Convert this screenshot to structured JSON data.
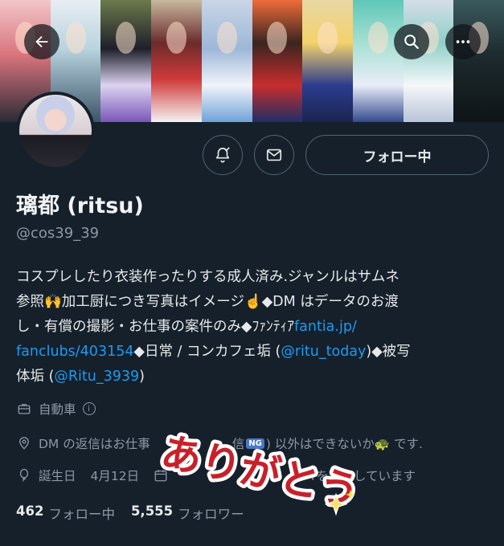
{
  "header": {
    "back_icon": "arrow-left-icon",
    "search_icon": "search-icon",
    "more_icon": "more-horizontal-icon"
  },
  "profile": {
    "name": "璃都 (ritsu)",
    "handle": "@cos39_39",
    "follow_button": "フォロー中",
    "bio": {
      "line1": "コスプレしたり衣装作ったりする成人済み.ジャンルはサムネ",
      "line2a": "参照🙌加工厨につき写真はイメージ☝️◆DM はデータのお渡",
      "line3a": "し・有償の撮影・お仕事の案件のみ◆ﾌｧﾝﾃｨｱ",
      "link1": "fantia.jp/",
      "link1b": "fanclubs/403154",
      "line4a": "◆日常 / コンカフェ垢 (",
      "link2": "@ritu_today",
      "line4b": ")◆被写",
      "line5a": "体垢 (",
      "link3": "@Ritu_3939",
      "line5b": ")"
    },
    "category": "自動車",
    "location_a": "DM の返信はお仕事",
    "location_b": "信",
    "ng_badge": "NG",
    "location_c": ") 以外はできないか🐢 です.",
    "birth_label": "誕生日",
    "birth_date": "4月12日",
    "joined_text": "rを利用しています",
    "following_count": "462",
    "following_label": "フォロー中",
    "followers_count": "5,555",
    "followers_label": "フォロワー"
  },
  "sticker": {
    "text": "ありがとう"
  },
  "colors": {
    "background": "#15202b",
    "link": "#1d9bf0",
    "muted": "#8b98a5"
  }
}
